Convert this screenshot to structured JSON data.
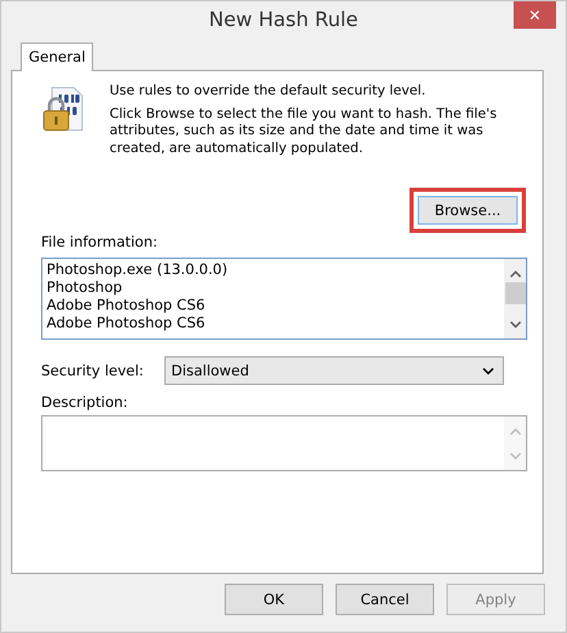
{
  "window": {
    "title": "New Hash Rule",
    "close": "✕"
  },
  "tabs": [
    {
      "label": "General",
      "selected": true
    }
  ],
  "intro": [
    "Use rules to override the default security level.",
    "Click Browse to select the file you want to hash. The file's attributes, such as its size and the date and time it was created, are automatically populated."
  ],
  "browse_button": {
    "label": "Browse...",
    "highlighted": true
  },
  "file_information": {
    "label": "File information:",
    "lines": [
      "Photoshop.exe (13.0.0.0)",
      "Photoshop",
      "Adobe Photoshop CS6",
      "Adobe Photoshop CS6"
    ]
  },
  "security_level": {
    "label": "Security level:",
    "value": "Disallowed"
  },
  "description": {
    "label": "Description:"
  },
  "buttons": [
    {
      "label": "OK",
      "disabled": false
    },
    {
      "label": "Cancel",
      "disabled": false
    },
    {
      "label": "Apply",
      "disabled": true
    }
  ]
}
